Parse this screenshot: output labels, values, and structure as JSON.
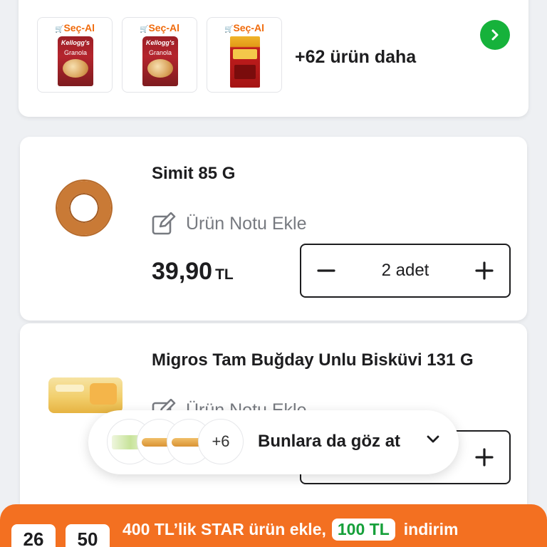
{
  "suggestions": {
    "items": [
      {
        "badge": "Seç-Al",
        "icon": "granola-pack-icon",
        "brand": "Kellogg's",
        "name": "Granola"
      },
      {
        "badge": "Seç-Al",
        "icon": "granola-pack-icon",
        "brand": "Kellogg's",
        "name": "Granola"
      },
      {
        "badge": "Seç-Al",
        "icon": "tea-box-icon"
      }
    ],
    "more_text": "+62 ürün daha",
    "go_icon": "chevron-right-icon",
    "colors": {
      "badge": "#f06a0b",
      "go": "#16b23b"
    }
  },
  "cart": {
    "items": [
      {
        "name": "Simit 85 G",
        "note_label": "Ürün Notu Ekle",
        "price": "39,90",
        "currency": "TL",
        "quantity": "2 adet",
        "image_icon": "simit-icon"
      },
      {
        "name": "Migros Tam Buğday Unlu Bisküvi 131 G",
        "note_label": "Ürün Notu Ekle",
        "image_icon": "biscuit-pack-icon"
      }
    ]
  },
  "suggest_pill": {
    "more_count": "+6",
    "label": "Bunlara da göz at",
    "chevron": "chevron-down-icon"
  },
  "promo": {
    "timer": [
      "26",
      "50"
    ],
    "text_before": "400 TL’lik STAR ürün ekle,",
    "badge": "100 TL",
    "text_after": "indirim",
    "colors": {
      "background": "#f37021",
      "badge_text": "#16a03a"
    }
  }
}
